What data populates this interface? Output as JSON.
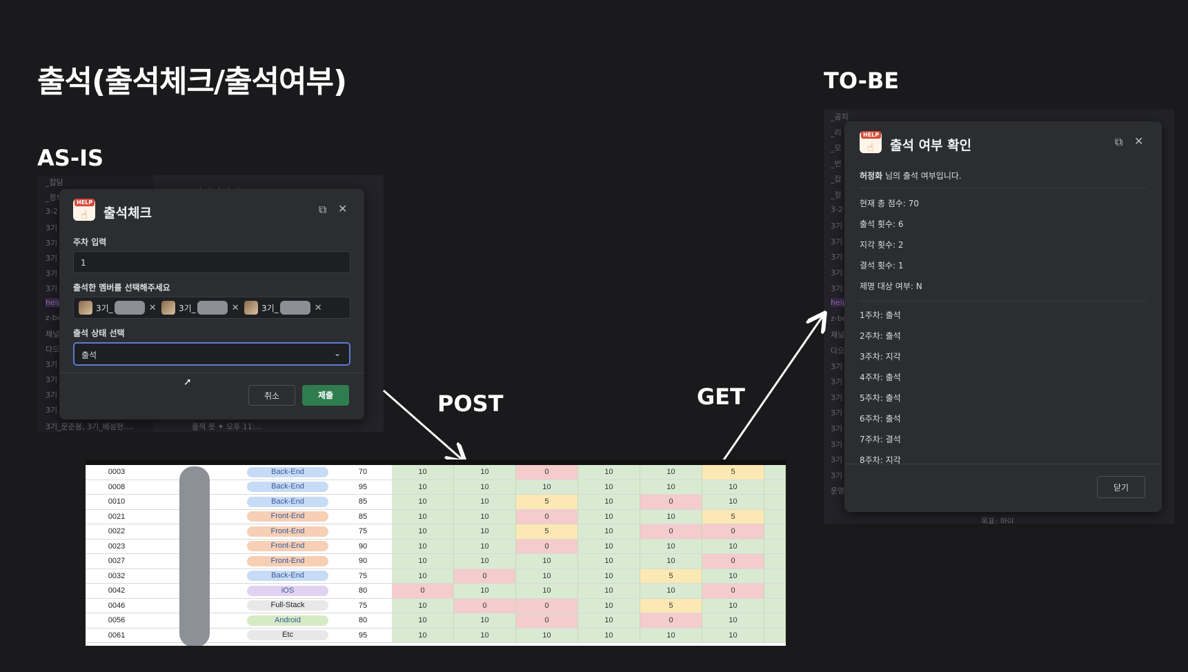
{
  "title": "출석(출석체크/출석여부)",
  "asis_label": "AS-IS",
  "tobe_label": "TO-BE",
  "post_label": "POST",
  "get_label": "GET",
  "asis_bg": {
    "lines": [
      "_잡담",
      "_정보공유",
      "3-2",
      "3기",
      "3기",
      "3기",
      "3기",
      "3기",
      "help",
      "z-be",
      "채널",
      "다으",
      "3기",
      "3기",
      "3기",
      "3기"
    ],
    "chat_top": "adadadadad",
    "footer": "3기_문준봉, 3기_배성현....",
    "footer2": "출첵 봇 ✦ 오후 11:..."
  },
  "checkin_modal": {
    "title": "출석체크",
    "week_label": "주차 입력",
    "week_value": "1",
    "member_label": "출석한 멤버를 선택해주세요",
    "members": [
      {
        "prefix": "3기_"
      },
      {
        "prefix": "3기_"
      },
      {
        "prefix": "3기_"
      }
    ],
    "status_label": "출석 상태 선택",
    "status_value": "출석",
    "cancel": "취소",
    "submit": "제출"
  },
  "status_modal": {
    "title": "출석 여부 확인",
    "user_name": "허정화",
    "user_suffix": " 님의 출석 여부입니다.",
    "summary": [
      "현재 총 점수: 70",
      "출석 횟수: 6",
      "지각 횟수: 2",
      "결석 횟수: 1",
      "제명 대상 여부: N"
    ],
    "weeks": [
      "1주차: 출석",
      "2주차: 출석",
      "3주차: 지각",
      "4주차: 출석",
      "5주차: 출석",
      "6주차: 출석",
      "7주차: 결석",
      "8주차: 지각"
    ],
    "close": "닫기"
  },
  "tobe_bg": {
    "lines": [
      "_공지",
      "_리",
      "_모",
      "_번",
      "_잡",
      "_정",
      "3-2",
      "3기",
      "3기",
      "3기",
      "3기",
      "3기",
      "help",
      "z-be",
      "채널",
      "다으",
      "3기",
      "3기",
      "3기",
      "3기",
      "3기",
      "3기",
      "3기",
      "3기",
      "운영"
    ],
    "footer": "목표: 하이"
  },
  "sheet": {
    "rows": [
      {
        "id": "0003",
        "track": "Back-End",
        "score": "70",
        "weeks": [
          "10",
          "10",
          "0",
          "10",
          "10",
          "5",
          ""
        ]
      },
      {
        "id": "0008",
        "track": "Back-End",
        "score": "95",
        "weeks": [
          "10",
          "10",
          "10",
          "10",
          "10",
          "10",
          ""
        ]
      },
      {
        "id": "0010",
        "track": "Back-End",
        "score": "85",
        "weeks": [
          "10",
          "10",
          "5",
          "10",
          "0",
          "10",
          ""
        ]
      },
      {
        "id": "0021",
        "track": "Front-End",
        "score": "85",
        "weeks": [
          "10",
          "10",
          "0",
          "10",
          "10",
          "5",
          ""
        ]
      },
      {
        "id": "0022",
        "track": "Front-End",
        "score": "75",
        "weeks": [
          "10",
          "10",
          "5",
          "10",
          "0",
          "0",
          ""
        ]
      },
      {
        "id": "0023",
        "track": "Front-End",
        "score": "90",
        "weeks": [
          "10",
          "10",
          "0",
          "10",
          "10",
          "10",
          ""
        ]
      },
      {
        "id": "0027",
        "track": "Front-End",
        "score": "90",
        "weeks": [
          "10",
          "10",
          "10",
          "10",
          "10",
          "0",
          ""
        ]
      },
      {
        "id": "0032",
        "track": "Back-End",
        "score": "75",
        "weeks": [
          "10",
          "0",
          "10",
          "10",
          "5",
          "10",
          ""
        ]
      },
      {
        "id": "0042",
        "track": "iOS",
        "score": "80",
        "weeks": [
          "0",
          "10",
          "10",
          "10",
          "10",
          "0",
          ""
        ]
      },
      {
        "id": "0046",
        "track": "Full-Stack",
        "score": "75",
        "weeks": [
          "10",
          "0",
          "0",
          "10",
          "5",
          "10",
          ""
        ]
      },
      {
        "id": "0056",
        "track": "Android",
        "score": "80",
        "weeks": [
          "10",
          "10",
          "0",
          "10",
          "0",
          "10",
          ""
        ]
      },
      {
        "id": "0061",
        "track": "Etc",
        "score": "95",
        "weeks": [
          "10",
          "10",
          "10",
          "10",
          "10",
          "10",
          ""
        ]
      }
    ],
    "track_colors": {
      "Back-End": "#c6dbf5",
      "Front-End": "#f6cfb4",
      "iOS": "#e2d2f2",
      "Full-Stack": "#e8e8e8",
      "Android": "#d4ebc4",
      "Etc": "#e8e8e8"
    },
    "score_colors": {
      "10": "#d9ead3",
      "5": "#fce8b2",
      "0": "#f4cccc",
      "": "#d9ead3"
    }
  }
}
